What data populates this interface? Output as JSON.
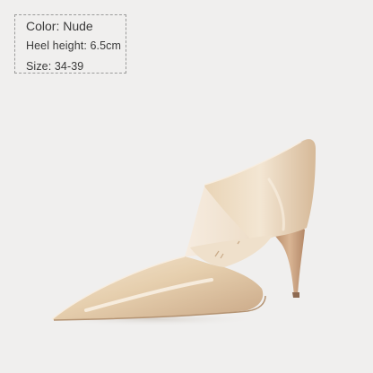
{
  "specs": {
    "color": "Color: Nude",
    "heel_height": "Heel height: 6.5cm",
    "size": "Size: 34-39"
  },
  "product": {
    "icon": "pointed-toe-pump-shoe",
    "colors": {
      "background": "#f0efee",
      "shoe_main": "#e2c9a6",
      "shoe_highlight": "#f5e9d7",
      "shoe_shadow": "#b9987a",
      "lining": "#f1e4d3",
      "heel": "#c99f7d"
    }
  }
}
